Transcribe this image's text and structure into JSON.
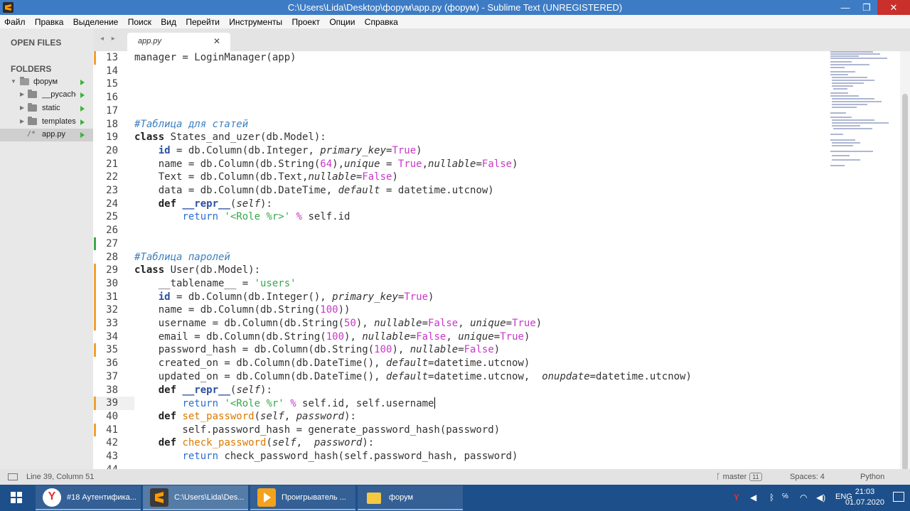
{
  "window": {
    "title": "C:\\Users\\Lida\\Desktop\\форум\\app.py (форум) - Sublime Text (UNREGISTERED)",
    "min": "—",
    "max": "❐",
    "close": "✕"
  },
  "menu": [
    "Файл",
    "Правка",
    "Выделение",
    "Поиск",
    "Вид",
    "Перейти",
    "Инструменты",
    "Проект",
    "Опции",
    "Справка"
  ],
  "sidebar": {
    "open_files": "OPEN FILES",
    "folders": "FOLDERS",
    "tree": [
      {
        "label": "форум"
      },
      {
        "label": "__pycache__"
      },
      {
        "label": "static"
      },
      {
        "label": "templates"
      },
      {
        "label": "app.py",
        "prefix": "/*"
      }
    ]
  },
  "tab": {
    "nav": "◂ ▸",
    "name": "app.py",
    "close": "✕"
  },
  "editor": {
    "line_numbers": [
      "13",
      "14",
      "15",
      "16",
      "17",
      "18",
      "19",
      "20",
      "21",
      "22",
      "23",
      "24",
      "25",
      "26",
      "27",
      "28",
      "29",
      "30",
      "31",
      "32",
      "33",
      "34",
      "35",
      "36",
      "37",
      "38",
      "39",
      "40",
      "41",
      "42",
      "43",
      "44"
    ],
    "current_line": "39"
  },
  "status": {
    "position": "Line 39, Column 51",
    "branch": "master",
    "branch_count": "11",
    "spaces": "Spaces: 4",
    "syntax": "Python"
  },
  "taskbar": {
    "tasks": [
      {
        "label": "#18 Аутентифика..."
      },
      {
        "label": "C:\\Users\\Lida\\Des..."
      },
      {
        "label": "Проигрыватель ..."
      },
      {
        "label": "форум"
      }
    ],
    "lang": "ENG",
    "time": "21:03",
    "date": "01.07.2020"
  }
}
